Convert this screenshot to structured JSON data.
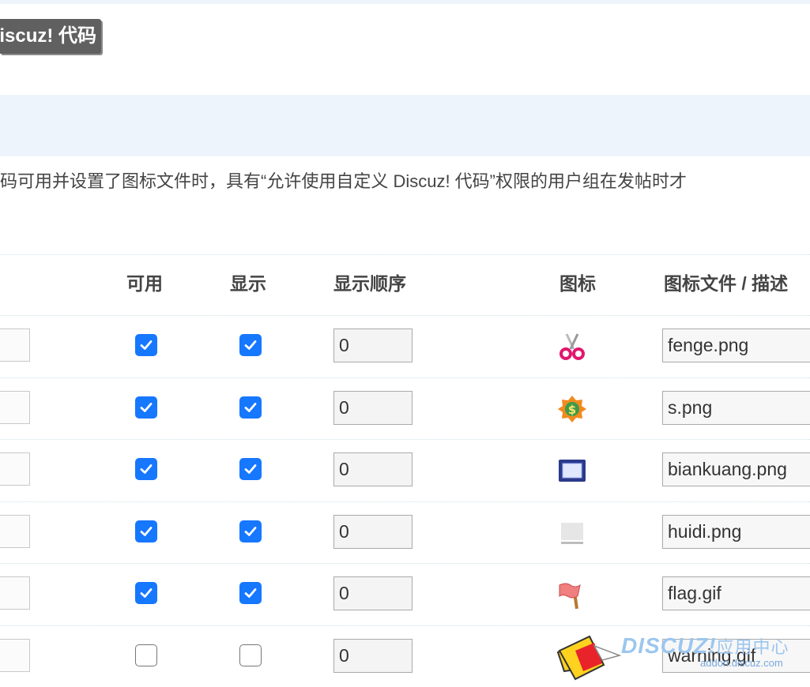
{
  "page": {
    "tag_label": "Discuz! 代码",
    "description": "代码可用并设置了图标文件时，具有“允许使用自定义 Discuz! 代码”权限的用户组在发帖时才"
  },
  "table": {
    "headers": {
      "available": "可用",
      "display": "显示",
      "order": "显示顺序",
      "icon": "图标",
      "file": "图标文件 / 描述"
    },
    "rows": [
      {
        "available": true,
        "display": true,
        "order": "0",
        "icon": "scissors-icon",
        "file": "fenge.png"
      },
      {
        "available": true,
        "display": true,
        "order": "0",
        "icon": "dollar-badge-icon",
        "file": "s.png"
      },
      {
        "available": true,
        "display": true,
        "order": "0",
        "icon": "frame-icon",
        "file": "biankuang.png"
      },
      {
        "available": true,
        "display": true,
        "order": "0",
        "icon": "gray-background-icon",
        "file": "huidi.png"
      },
      {
        "available": true,
        "display": true,
        "order": "0",
        "icon": "flag-icon",
        "file": "flag.gif"
      },
      {
        "available": false,
        "display": false,
        "order": "0",
        "icon": "warning-icon",
        "file": "warning.gif"
      }
    ]
  },
  "watermark": {
    "brand": "DISCUZ!",
    "brand_cn": "应用中心",
    "url": "addon.discuz.com"
  },
  "colors": {
    "checkbox_on": "#1677ff",
    "tag_bg": "#606060",
    "band_bg": "#eef4fb"
  }
}
